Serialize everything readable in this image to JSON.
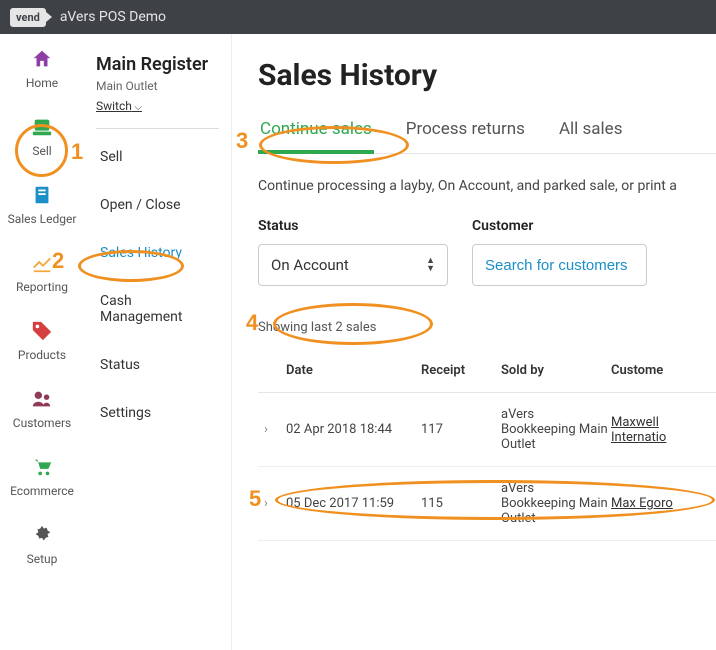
{
  "topbar": {
    "logo": "vend",
    "title": "aVers POS Demo"
  },
  "rail": [
    {
      "label": "Home",
      "icon": "home",
      "color": "#8d3fa5"
    },
    {
      "label": "Sell",
      "icon": "register",
      "color": "#2fa84f"
    },
    {
      "label": "Sales Ledger",
      "icon": "ledger",
      "color": "#1a8fc8"
    },
    {
      "label": "Reporting",
      "icon": "reporting",
      "color": "#f2a93b"
    },
    {
      "label": "Products",
      "icon": "tag",
      "color": "#d63f3f"
    },
    {
      "label": "Customers",
      "icon": "customers",
      "color": "#8f3b56"
    },
    {
      "label": "Ecommerce",
      "icon": "cart",
      "color": "#2fa84f"
    },
    {
      "label": "Setup",
      "icon": "gear",
      "color": "#555"
    }
  ],
  "sidebar": {
    "title": "Main Register",
    "subtitle": "Main Outlet",
    "switch": "Switch",
    "items": [
      "Sell",
      "Open / Close",
      "Sales History",
      "Cash Management",
      "Status",
      "Settings"
    ],
    "active_index": 2
  },
  "page": {
    "title": "Sales History",
    "tabs": [
      "Continue sales",
      "Process returns",
      "All sales"
    ],
    "active_tab": 0,
    "helper": "Continue processing a layby, On Account, and parked sale, or print a",
    "filters": {
      "status_label": "Status",
      "status_value": "On Account",
      "customer_label": "Customer",
      "customer_placeholder": "Search for customers"
    },
    "showing": "Showing last 2 sales",
    "columns": {
      "date": "Date",
      "receipt": "Receipt",
      "soldby": "Sold by",
      "customer": "Custome"
    },
    "rows": [
      {
        "date": "02 Apr 2018 18:44",
        "receipt": "117",
        "soldby": "aVers Bookkeeping Main Outlet",
        "customer": "Maxwell Internatio"
      },
      {
        "date": "05 Dec 2017 11:59",
        "receipt": "115",
        "soldby": "aVers Bookkeeping Main Outlet",
        "customer": "Max Egoro"
      }
    ]
  },
  "annotations": [
    "1",
    "2",
    "3",
    "4",
    "5"
  ]
}
